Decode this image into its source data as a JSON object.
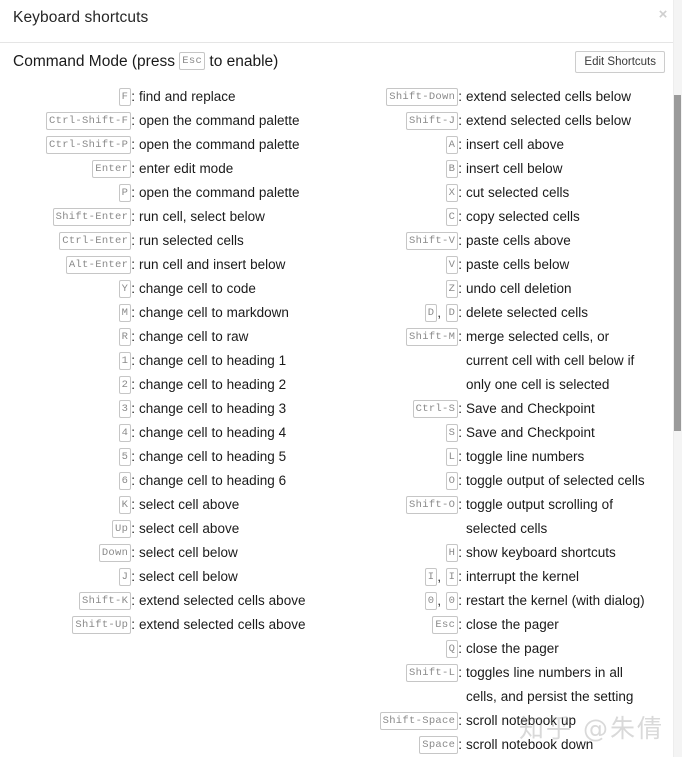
{
  "modal": {
    "title": "Keyboard shortcuts",
    "close_icon": "close-icon",
    "close_label": "×"
  },
  "section": {
    "title_prefix": "Command Mode (press",
    "title_key": "Esc",
    "title_suffix": "to enable)",
    "edit_button_label": "Edit Shortcuts"
  },
  "watermark": {
    "text": "知乎 @朱倩"
  },
  "colors": {
    "text": "#1a1a1a",
    "kbd_text": "#8a8a8a",
    "kbd_border": "#c6c6c6",
    "divider": "#e5e5e5",
    "close": "#cfcfcf",
    "scroll_thumb": "#9a9a9a",
    "scroll_track": "#f4f4f4"
  },
  "shortcuts": {
    "left": [
      {
        "keys": [
          "F"
        ],
        "desc": "find and replace"
      },
      {
        "keys": [
          "Ctrl-Shift-F"
        ],
        "desc": "open the command palette"
      },
      {
        "keys": [
          "Ctrl-Shift-P"
        ],
        "desc": "open the command palette"
      },
      {
        "keys": [
          "Enter"
        ],
        "desc": "enter edit mode"
      },
      {
        "keys": [
          "P"
        ],
        "desc": "open the command palette"
      },
      {
        "keys": [
          "Shift-Enter"
        ],
        "desc": "run cell, select below"
      },
      {
        "keys": [
          "Ctrl-Enter"
        ],
        "desc": "run selected cells"
      },
      {
        "keys": [
          "Alt-Enter"
        ],
        "desc": "run cell and insert below"
      },
      {
        "keys": [
          "Y"
        ],
        "desc": "change cell to code"
      },
      {
        "keys": [
          "M"
        ],
        "desc": "change cell to markdown"
      },
      {
        "keys": [
          "R"
        ],
        "desc": "change cell to raw"
      },
      {
        "keys": [
          "1"
        ],
        "desc": "change cell to heading 1"
      },
      {
        "keys": [
          "2"
        ],
        "desc": "change cell to heading 2"
      },
      {
        "keys": [
          "3"
        ],
        "desc": "change cell to heading 3"
      },
      {
        "keys": [
          "4"
        ],
        "desc": "change cell to heading 4"
      },
      {
        "keys": [
          "5"
        ],
        "desc": "change cell to heading 5"
      },
      {
        "keys": [
          "6"
        ],
        "desc": "change cell to heading 6"
      },
      {
        "keys": [
          "K"
        ],
        "desc": "select cell above"
      },
      {
        "keys": [
          "Up"
        ],
        "desc": "select cell above"
      },
      {
        "keys": [
          "Down"
        ],
        "desc": "select cell below"
      },
      {
        "keys": [
          "J"
        ],
        "desc": "select cell below"
      },
      {
        "keys": [
          "Shift-K"
        ],
        "desc": "extend selected cells above"
      },
      {
        "keys": [
          "Shift-Up"
        ],
        "desc": "extend selected cells above"
      }
    ],
    "right": [
      {
        "keys": [
          "Shift-Down"
        ],
        "desc": "extend selected cells below"
      },
      {
        "keys": [
          "Shift-J"
        ],
        "desc": "extend selected cells below"
      },
      {
        "keys": [
          "A"
        ],
        "desc": "insert cell above"
      },
      {
        "keys": [
          "B"
        ],
        "desc": "insert cell below"
      },
      {
        "keys": [
          "X"
        ],
        "desc": "cut selected cells"
      },
      {
        "keys": [
          "C"
        ],
        "desc": "copy selected cells"
      },
      {
        "keys": [
          "Shift-V"
        ],
        "desc": "paste cells above"
      },
      {
        "keys": [
          "V"
        ],
        "desc": "paste cells below"
      },
      {
        "keys": [
          "Z"
        ],
        "desc": "undo cell deletion"
      },
      {
        "keys": [
          "D",
          "D"
        ],
        "desc": "delete selected cells"
      },
      {
        "keys": [
          "Shift-M"
        ],
        "desc": "merge selected cells, or current cell with cell below if only one cell is selected"
      },
      {
        "keys": [
          "Ctrl-S"
        ],
        "desc": "Save and Checkpoint"
      },
      {
        "keys": [
          "S"
        ],
        "desc": "Save and Checkpoint"
      },
      {
        "keys": [
          "L"
        ],
        "desc": "toggle line numbers"
      },
      {
        "keys": [
          "O"
        ],
        "desc": "toggle output of selected cells"
      },
      {
        "keys": [
          "Shift-O"
        ],
        "desc": "toggle output scrolling of selected cells"
      },
      {
        "keys": [
          "H"
        ],
        "desc": "show keyboard shortcuts"
      },
      {
        "keys": [
          "I",
          "I"
        ],
        "desc": "interrupt the kernel"
      },
      {
        "keys": [
          "0",
          "0"
        ],
        "desc": "restart the kernel (with dialog)"
      },
      {
        "keys": [
          "Esc"
        ],
        "desc": "close the pager"
      },
      {
        "keys": [
          "Q"
        ],
        "desc": "close the pager"
      },
      {
        "keys": [
          "Shift-L"
        ],
        "desc": "toggles line numbers in all cells, and persist the setting"
      },
      {
        "keys": [
          "Shift-Space"
        ],
        "desc": "scroll notebook up"
      },
      {
        "keys": [
          "Space"
        ],
        "desc": "scroll notebook down"
      }
    ]
  }
}
